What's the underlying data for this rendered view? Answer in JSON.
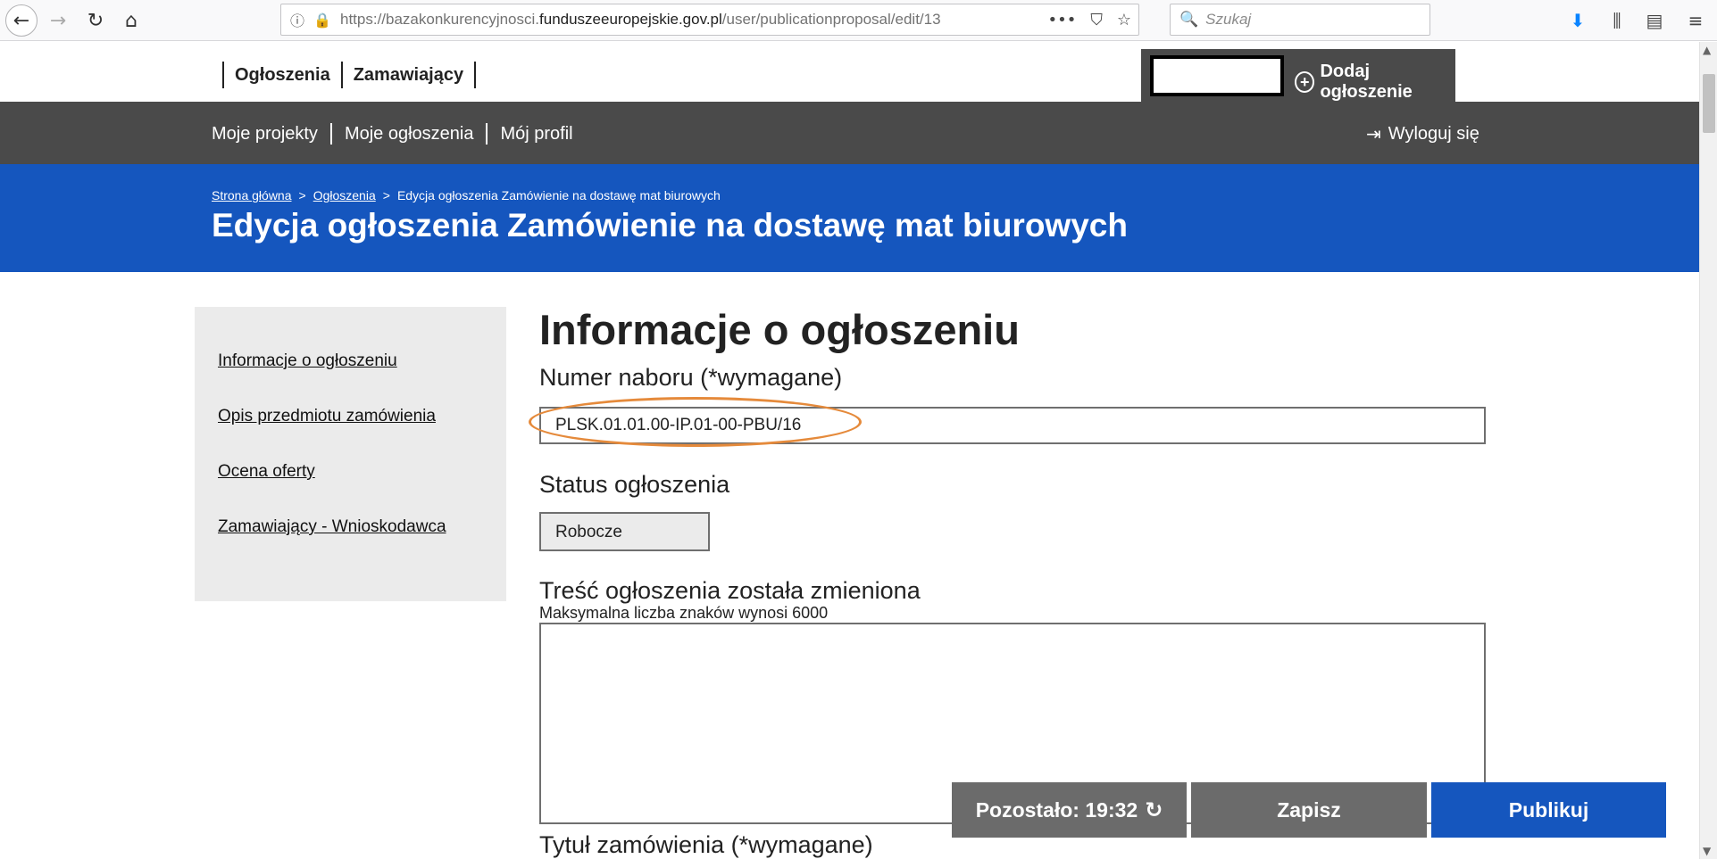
{
  "browser": {
    "url_prefix": "https://bazakonkurencyjnosci.",
    "url_domain": "funduszeeuropejskie.gov.pl",
    "url_path": "/user/publicationproposal/edit/13",
    "search_placeholder": "Szukaj",
    "icons": {
      "back": "arrow-left-icon",
      "forward": "arrow-right-icon",
      "reload": "reload-icon",
      "home": "home-icon",
      "info": "info-icon",
      "lock": "lock-icon",
      "more": "more-icon",
      "pocket": "pocket-icon",
      "bookmark": "star-icon",
      "search": "search-icon",
      "download": "download-icon",
      "library": "library-icon",
      "sidebar": "sidebar-icon",
      "menu": "hamburger-icon"
    },
    "glyphs": {
      "back": "←",
      "forward": "→",
      "reload": "↻",
      "home": "⌂",
      "info": "ⓘ",
      "lock": "🔒",
      "more": "•••",
      "pocket": "⛉",
      "bookmark": "☆",
      "search": "🔍",
      "download": "⬇",
      "library": "⫼",
      "sidebar": "▤",
      "menu": "≡"
    }
  },
  "topnav": {
    "link1": "Ogłoszenia",
    "link2": "Zamawiający",
    "add_label": "Dodaj ogłoszenie",
    "add_icon_glyph": "+"
  },
  "subnav": {
    "items": [
      "Moje projekty",
      "Moje ogłoszenia",
      "Mój profil"
    ],
    "logout_label": "Wyloguj się",
    "logout_icon_glyph": "⇥"
  },
  "hero": {
    "crumbs": [
      "Strona główna",
      "Ogłoszenia",
      "Edycja ogłoszenia Zamówienie na dostawę mat biurowych"
    ],
    "crumb_sep": ">",
    "title": "Edycja ogłoszenia Zamówienie na dostawę mat biurowych"
  },
  "sidemenu": {
    "items": [
      "Informacje o ogłoszeniu",
      "Opis przedmiotu zamówienia",
      "Ocena oferty",
      "Zamawiający - Wnioskodawca"
    ]
  },
  "form": {
    "section_title": "Informacje o ogłoszeniu",
    "numer_label": "Numer naboru (*wymagane)",
    "numer_value": "PLSK.01.01.00-IP.01-00-PBU/16",
    "status_label": "Status ogłoszenia",
    "status_value": "Robocze",
    "changed_label": "Treść ogłoszenia została zmieniona",
    "changed_hint": "Maksymalna liczba znaków wynosi 6000",
    "changed_value": "",
    "title_label": "Tytuł zamówienia (*wymagane)"
  },
  "actions": {
    "timer_label": "Pozostało: 19:32",
    "timer_icon_glyph": "↻",
    "save_label": "Zapisz",
    "publish_label": "Publikuj"
  },
  "colors": {
    "accent_blue": "#1556be",
    "dark_gray": "#4a4a4a",
    "button_gray": "#6b6b6b",
    "highlight_orange": "#e58a3b"
  }
}
